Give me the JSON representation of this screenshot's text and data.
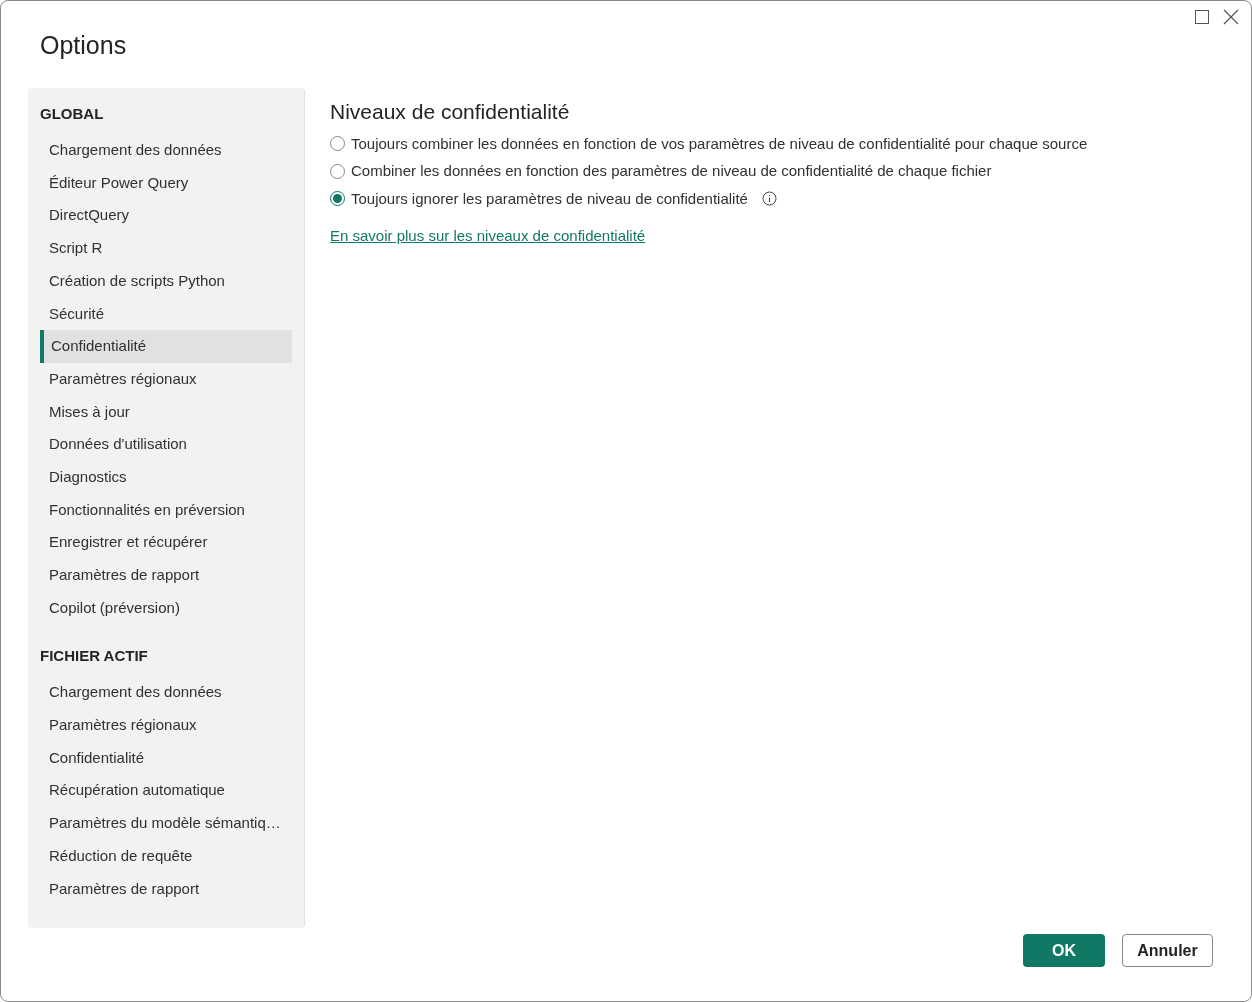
{
  "window": {
    "title": "Options"
  },
  "sidebar": {
    "sections": [
      {
        "heading": "GLOBAL",
        "items": [
          {
            "label": "Chargement des données",
            "selected": false
          },
          {
            "label": "Éditeur Power Query",
            "selected": false
          },
          {
            "label": "DirectQuery",
            "selected": false
          },
          {
            "label": "Script R",
            "selected": false
          },
          {
            "label": "Création de scripts Python",
            "selected": false
          },
          {
            "label": "Sécurité",
            "selected": false
          },
          {
            "label": "Confidentialité",
            "selected": true
          },
          {
            "label": "Paramètres régionaux",
            "selected": false
          },
          {
            "label": "Mises à jour",
            "selected": false
          },
          {
            "label": "Données d'utilisation",
            "selected": false
          },
          {
            "label": "Diagnostics",
            "selected": false
          },
          {
            "label": "Fonctionnalités en préversion",
            "selected": false
          },
          {
            "label": "Enregistrer et récupérer",
            "selected": false
          },
          {
            "label": "Paramètres de rapport",
            "selected": false
          },
          {
            "label": "Copilot (préversion)",
            "selected": false
          }
        ]
      },
      {
        "heading": "FICHIER ACTIF",
        "items": [
          {
            "label": "Chargement des données",
            "selected": false
          },
          {
            "label": "Paramètres régionaux",
            "selected": false
          },
          {
            "label": "Confidentialité",
            "selected": false
          },
          {
            "label": "Récupération automatique",
            "selected": false
          },
          {
            "label": "Paramètres du modèle sémantiq…",
            "selected": false
          },
          {
            "label": "Réduction de requête",
            "selected": false
          },
          {
            "label": "Paramètres de rapport",
            "selected": false
          }
        ]
      }
    ]
  },
  "content": {
    "heading": "Niveaux de confidentialité",
    "options": [
      {
        "label": "Toujours combiner les données en fonction de vos paramètres de niveau de confidentialité pour chaque source",
        "selected": false,
        "info": false
      },
      {
        "label": "Combiner les données en fonction des paramètres de niveau de confidentialité de chaque fichier",
        "selected": false,
        "info": false
      },
      {
        "label": "Toujours ignorer les paramètres de niveau de confidentialité",
        "selected": true,
        "info": true
      }
    ],
    "link": "En savoir plus sur les niveaux de confidentialité"
  },
  "buttons": [
    {
      "label": "OK",
      "kind": "primary"
    },
    {
      "label": "Annuler",
      "kind": "secondary"
    }
  ]
}
